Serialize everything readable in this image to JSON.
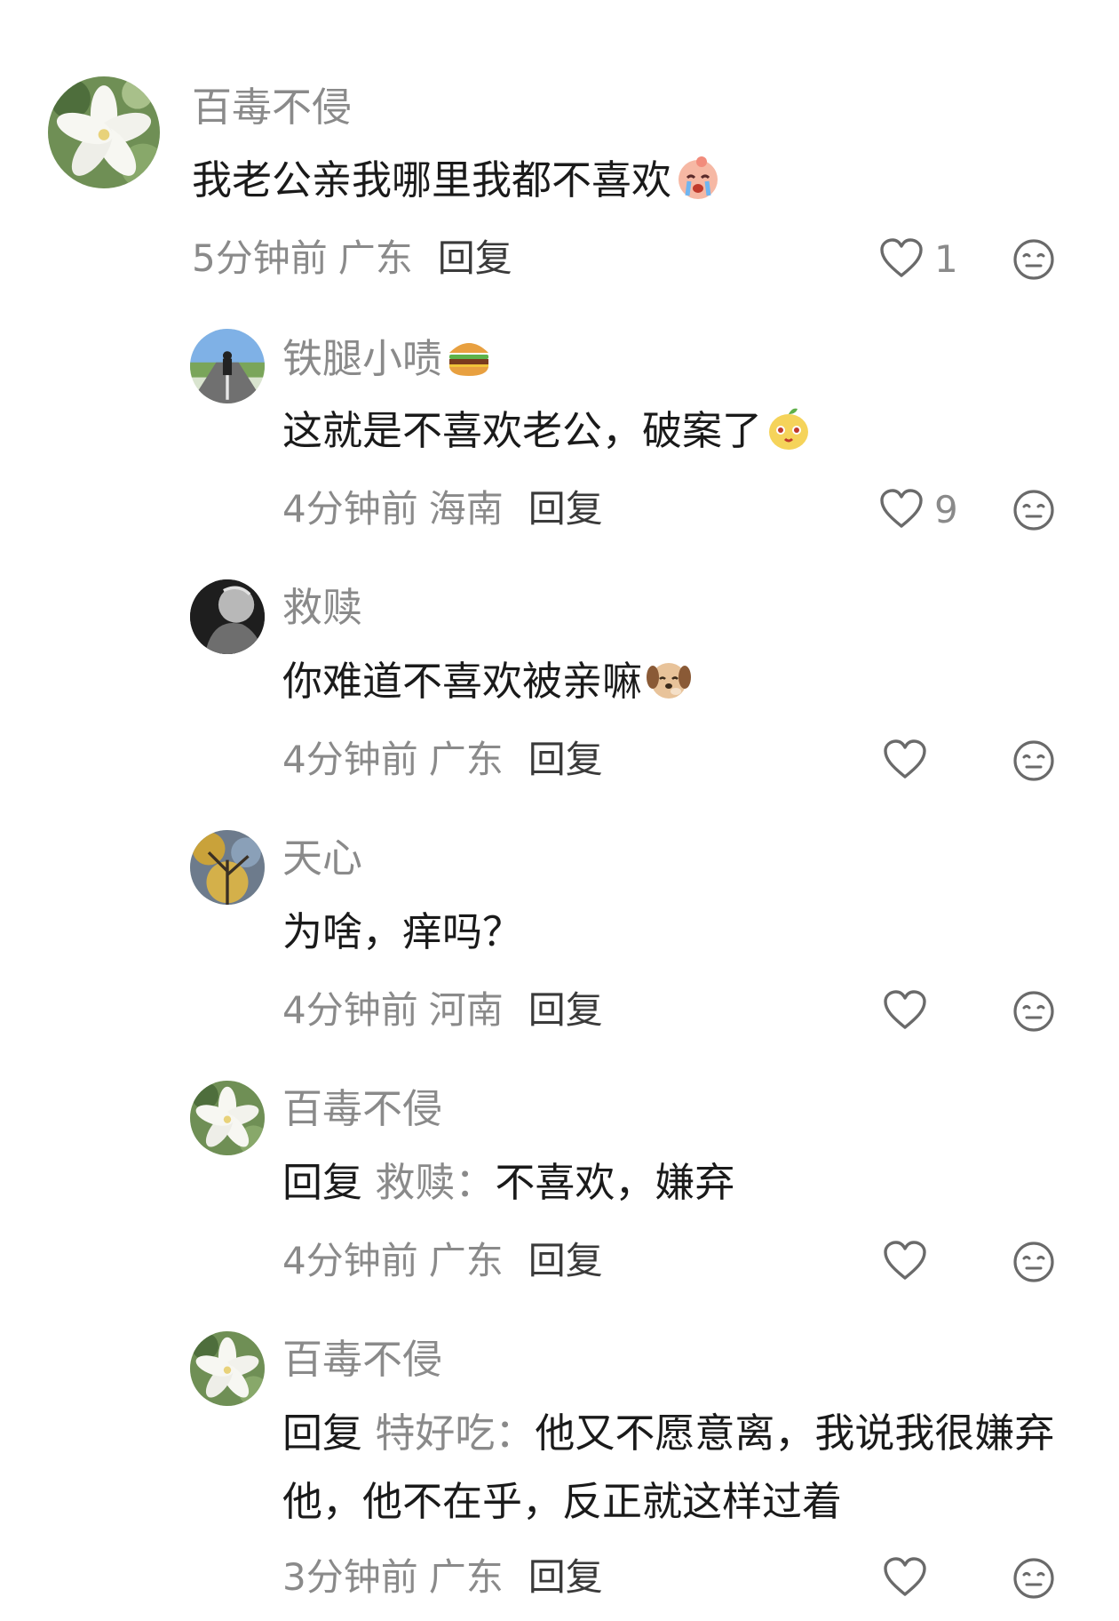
{
  "comments": [
    {
      "name": "百毒不侵",
      "text": "我老公亲我哪里我都不喜欢",
      "emoji_icon": "crying-face-icon",
      "time": "5分钟前",
      "location": "广东",
      "reply_label": "回复",
      "likes": "1"
    },
    {
      "name": "铁腿小啧",
      "name_emoji_icon": "hamburger-icon",
      "text": "这就是不喜欢老公，破案了",
      "emoji_icon": "yellow-face-icon",
      "time": "4分钟前",
      "location": "海南",
      "reply_label": "回复",
      "likes": "9"
    },
    {
      "name": "救赎",
      "text": "你难道不喜欢被亲嘛",
      "emoji_icon": "dog-face-icon",
      "time": "4分钟前",
      "location": "广东",
      "reply_label": "回复",
      "likes": ""
    },
    {
      "name": "天心",
      "text": "为啥，痒吗？",
      "time": "4分钟前",
      "location": "河南",
      "reply_label": "回复",
      "likes": ""
    },
    {
      "name": "百毒不侵",
      "reply_prefix": "回复",
      "reply_target": "救赎：",
      "text": "不喜欢，嫌弃",
      "time": "4分钟前",
      "location": "广东",
      "reply_label": "回复",
      "likes": ""
    },
    {
      "name": "百毒不侵",
      "reply_prefix": "回复",
      "reply_target": "特好吃：",
      "text": "他又不愿意离，我说我很嫌弃他，他不在乎，反正就这样过着",
      "time": "3分钟前",
      "location": "广东",
      "reply_label": "回复",
      "likes": ""
    }
  ],
  "colors": {
    "text_primary": "#1a1a1a",
    "text_secondary": "#8a8a8a",
    "icon": "#6a6a6a"
  }
}
